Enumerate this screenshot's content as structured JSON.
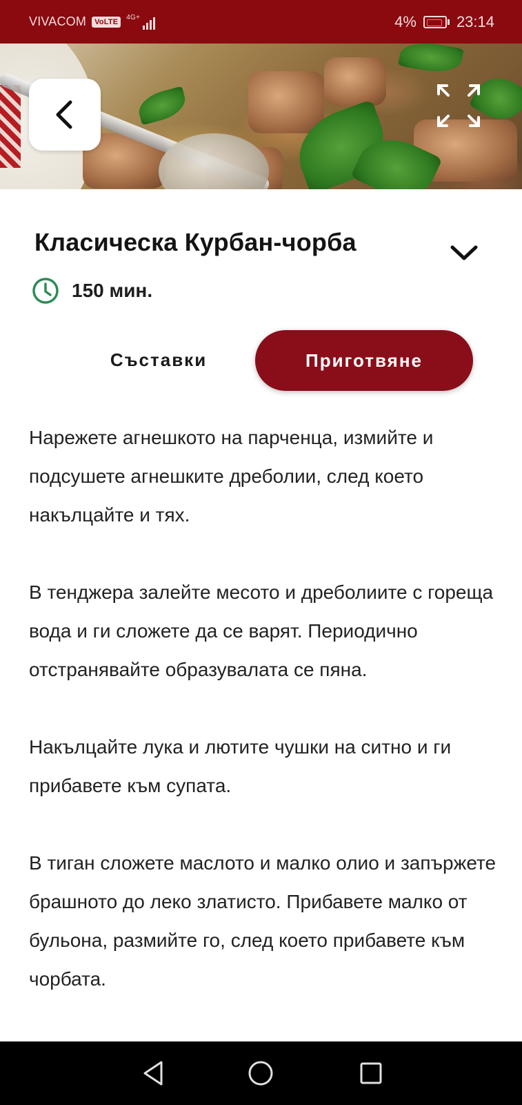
{
  "status_bar": {
    "carrier": "VIVACOM",
    "volte": "VoLTE",
    "network": "4G+",
    "battery_percent": "4%",
    "time": "23:14"
  },
  "recipe": {
    "title": "Класическа Курбан-чорба",
    "time": "150 мин."
  },
  "tabs": {
    "ingredients_label": "Съставки",
    "preparation_label": "Приготвяне",
    "active": "preparation"
  },
  "steps": [
    "Нарежете агнешкото на парченца, измийте и подсушете агнешките дреболии, след което накълцайте и тях.",
    "В тенджера залейте месото и дреболиите с гореща вода и ги сложете да се варят. Периодично отстранявайте образувалата се пяна.",
    "Накълцайте лука и лютите чушки на ситно и ги прибавете към супата.",
    "В тиган сложете маслото и малко олио и запържете брашното до леко златисто. Прибавете малко от бульона, размийте го, след което прибавете към чорбата."
  ],
  "colors": {
    "status_bar": "#8a0a0f",
    "accent": "#8a0e1a",
    "clock_icon": "#2e8b57",
    "nav_bar": "#000000"
  },
  "icons": {
    "back": "chevron-left-icon",
    "expand": "expand-icon",
    "collapse": "chevron-down-icon",
    "time": "clock-icon",
    "nav_back": "triangle-back-icon",
    "nav_home": "circle-home-icon",
    "nav_recents": "square-recents-icon"
  }
}
